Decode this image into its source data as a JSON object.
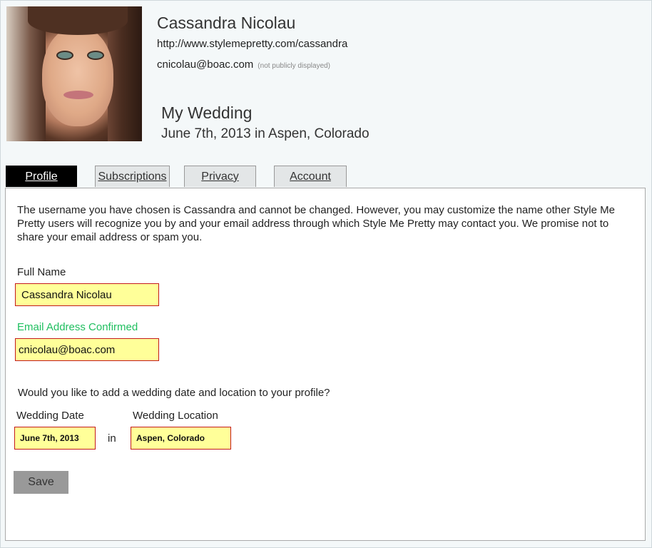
{
  "profile": {
    "name": "Cassandra Nicolau",
    "url": "http://www.stylemepretty.com/cassandra",
    "email": "cnicolau@boac.com",
    "email_note": "(not publicly displayed)",
    "wedding_title": "My Wedding",
    "wedding_summary": "June 7th, 2013 in Aspen, Colorado"
  },
  "tabs": [
    {
      "label": "Profile",
      "active": true
    },
    {
      "label": "Subscriptions",
      "active": false
    },
    {
      "label": "Privacy",
      "active": false
    },
    {
      "label": "Account",
      "active": false
    }
  ],
  "form": {
    "intro": "The username you have chosen is Cassandra and cannot be changed. However, you may customize the name other Style Me Pretty users will recognize you by and your email address through which Style Me Pretty may contact you. We promise not to share your email address or spam you.",
    "full_name_label": "Full Name",
    "full_name_value": "Cassandra Nicolau",
    "email_label": "Email Address Confirmed",
    "email_value": "cnicolau@boac.com",
    "wedding_question": "Would you like to add a wedding date and location to your profile?",
    "wedding_date_label": "Wedding Date",
    "wedding_date_value": "June 7th, 2013",
    "in_word": "in",
    "wedding_location_label": "Wedding Location",
    "wedding_location_value": "Aspen, Colorado",
    "save_label": "Save"
  },
  "colors": {
    "field_bg": "#ffff99",
    "field_border": "#c41a1a",
    "confirmed_green": "#1fbf5f",
    "active_tab": "#000000"
  }
}
